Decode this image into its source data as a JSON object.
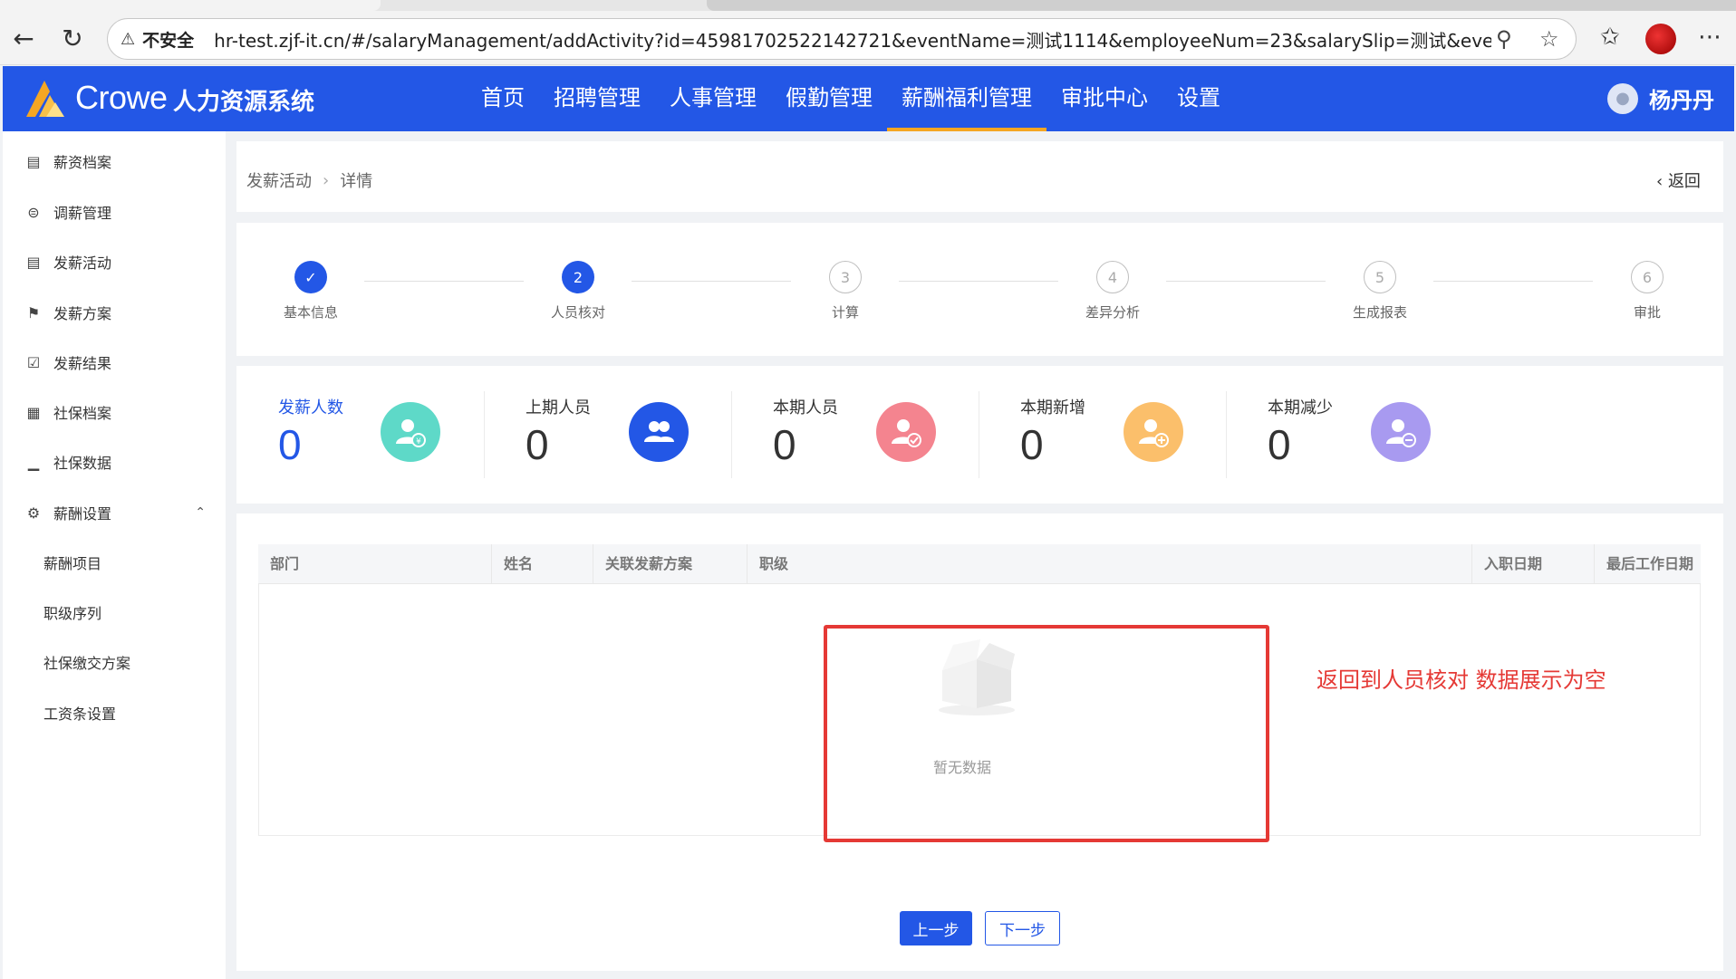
{
  "browser": {
    "security_label": "不安全",
    "url": "hr-test.zjf-it.cn/#/salaryManagement/addActivity?id=4598170252214272 1&eventName=测试1114&employeeNum=23&salarySlip=测试&eventStatus...",
    "url_display": "hr-test.zjf-it.cn/#/salaryManagement/addActivity?id=45981702522142721&eventName=测试1114&employeeNum=23&salarySlip=测试&eventStatus..."
  },
  "header": {
    "brand": "Crowe",
    "system_name": "人力资源系统",
    "menu": [
      "首页",
      "招聘管理",
      "人事管理",
      "假勤管理",
      "薪酬福利管理",
      "审批中心",
      "设置"
    ],
    "active_menu": "薪酬福利管理",
    "user_name": "杨丹丹"
  },
  "sidebar": {
    "items": [
      {
        "label": "薪资档案",
        "icon": "document-icon"
      },
      {
        "label": "调薪管理",
        "icon": "exchange-icon"
      },
      {
        "label": "发薪活动",
        "icon": "list-icon"
      },
      {
        "label": "发薪方案",
        "icon": "flag-icon"
      },
      {
        "label": "发薪结果",
        "icon": "clipboard-check-icon"
      },
      {
        "label": "社保档案",
        "icon": "grid-icon"
      },
      {
        "label": "社保数据",
        "icon": "bar-chart-icon"
      },
      {
        "label": "薪酬设置",
        "icon": "gear-icon"
      }
    ],
    "sub_items": [
      "薪酬项目",
      "职级序列",
      "社保缴交方案",
      "工资条设置"
    ]
  },
  "breadcrumb": {
    "parent": "发薪活动",
    "current": "详情",
    "back": "返回"
  },
  "steps": [
    {
      "num": "✓",
      "label": "基本信息",
      "state": "done"
    },
    {
      "num": "2",
      "label": "人员核对",
      "state": "current"
    },
    {
      "num": "3",
      "label": "计算",
      "state": "pending"
    },
    {
      "num": "4",
      "label": "差异分析",
      "state": "pending"
    },
    {
      "num": "5",
      "label": "生成报表",
      "state": "pending"
    },
    {
      "num": "6",
      "label": "审批",
      "state": "pending"
    }
  ],
  "stats": [
    {
      "label": "发薪人数",
      "value": "0",
      "color": "#5ed9c8"
    },
    {
      "label": "上期人员",
      "value": "0",
      "color": "#2357e6"
    },
    {
      "label": "本期人员",
      "value": "0",
      "color": "#f4848f"
    },
    {
      "label": "本期新增",
      "value": "0",
      "color": "#fbbf6b"
    },
    {
      "label": "本期减少",
      "value": "0",
      "color": "#a89af0"
    }
  ],
  "table": {
    "columns": [
      "部门",
      "姓名",
      "关联发薪方案",
      "职级",
      "入职日期",
      "最后工作日期"
    ],
    "empty_text": "暂无数据"
  },
  "annotation": "返回到人员核对 数据展示为空",
  "buttons": {
    "prev": "上一步",
    "next": "下一步"
  },
  "colors": {
    "primary": "#2357e6",
    "active_underline": "#f5a623",
    "annotation_red": "#e53935"
  }
}
